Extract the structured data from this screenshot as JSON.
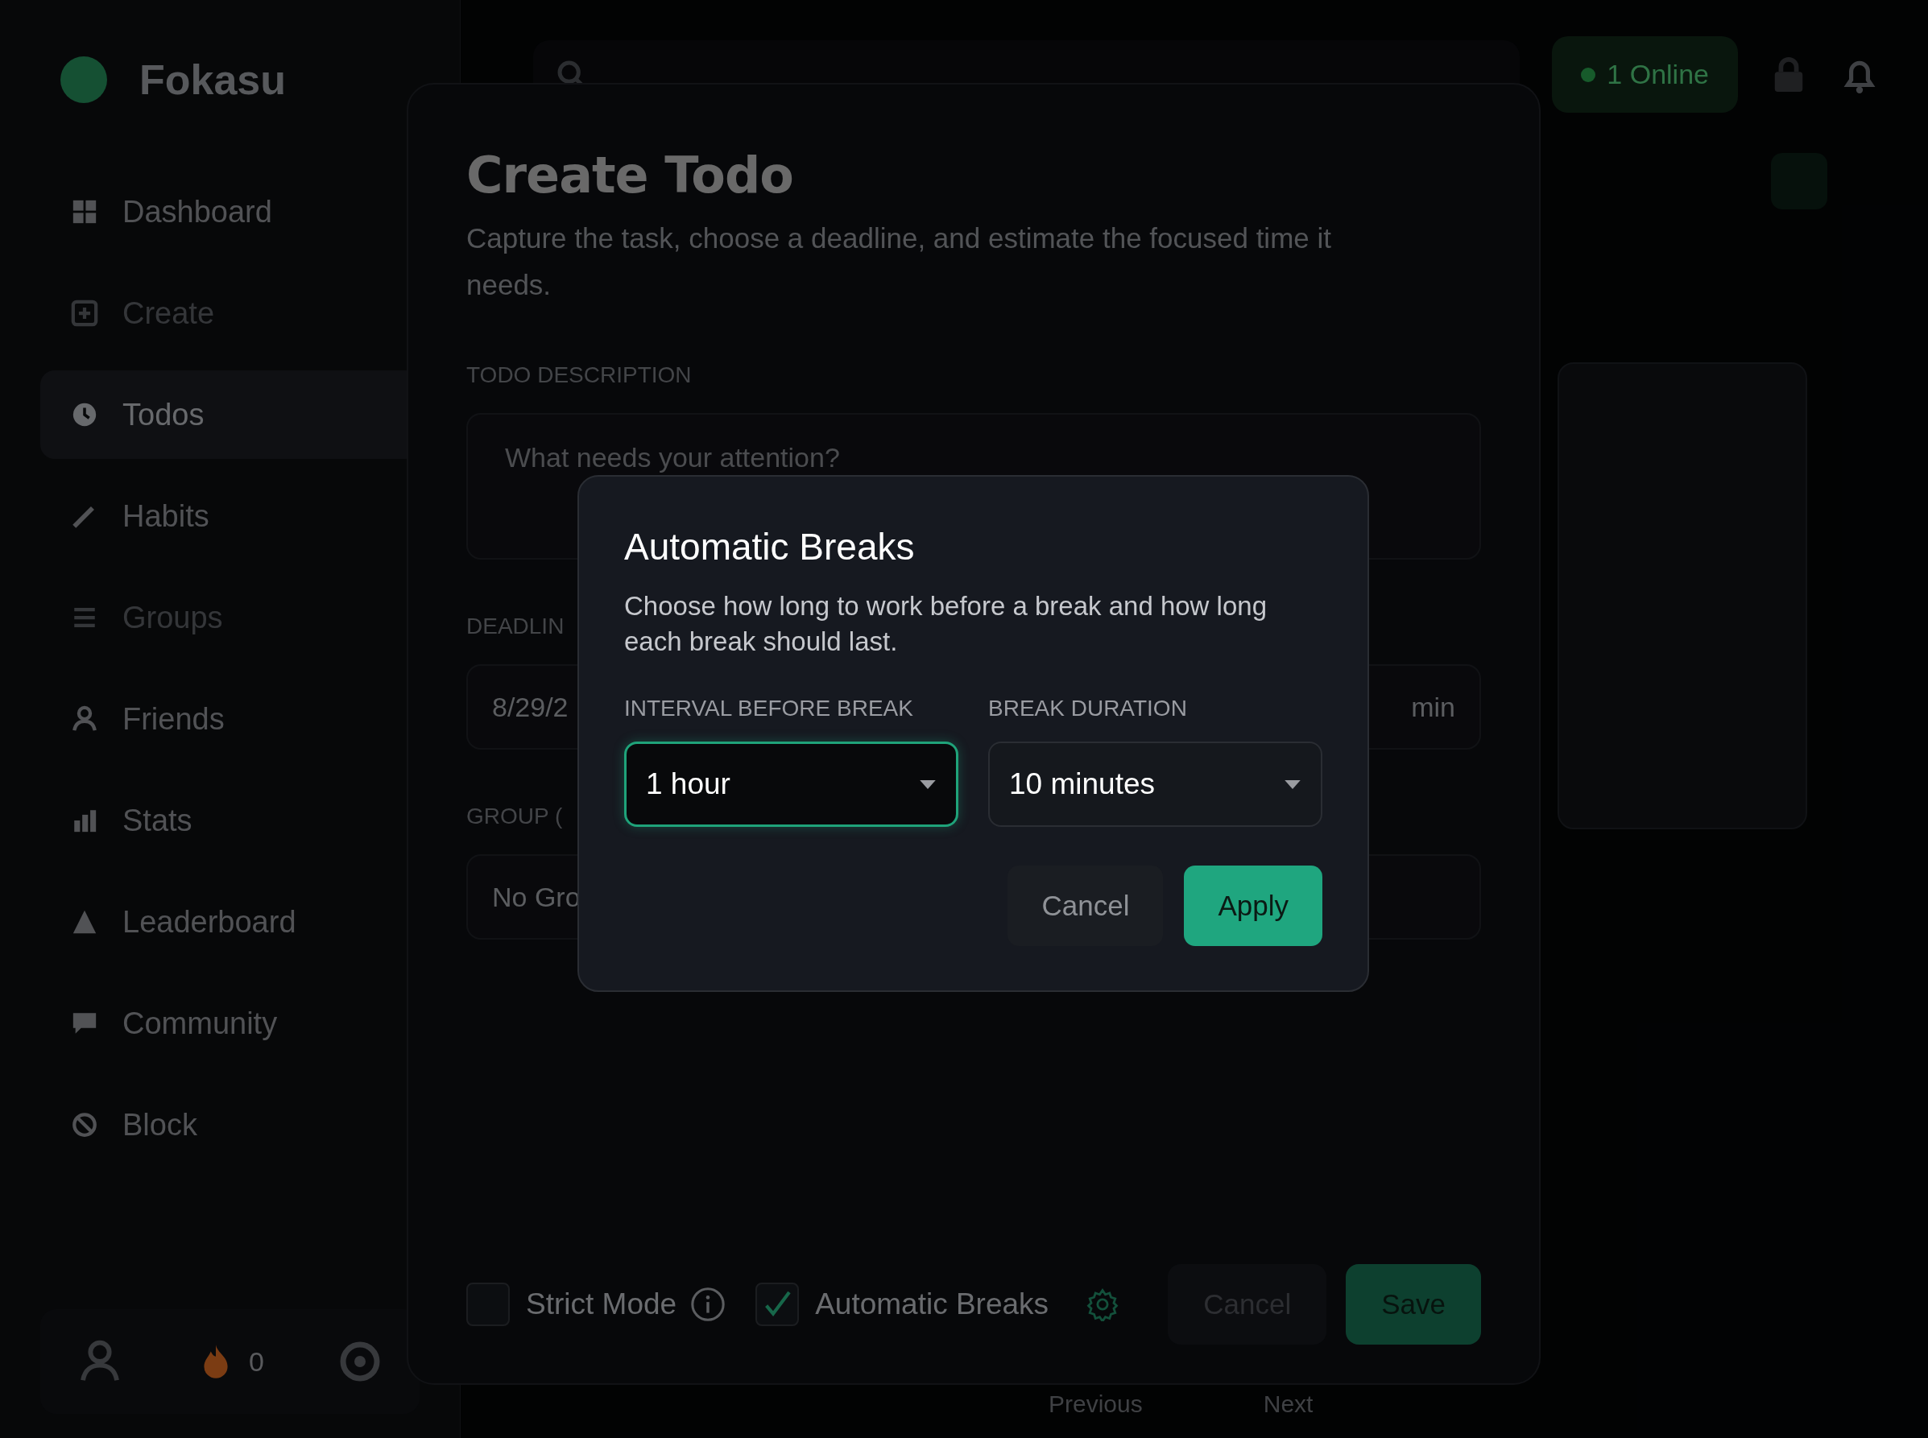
{
  "app": {
    "brand": "Fokasu",
    "sidebar": {
      "items": [
        {
          "label": "Dashboard",
          "selected": false,
          "disabled": false
        },
        {
          "label": "Create",
          "selected": false,
          "disabled": true
        },
        {
          "label": "Todos",
          "selected": true,
          "disabled": false
        },
        {
          "label": "Habits",
          "selected": false,
          "disabled": false
        },
        {
          "label": "Groups",
          "selected": false,
          "disabled": true
        },
        {
          "label": "Friends",
          "selected": false,
          "disabled": false
        },
        {
          "label": "Stats",
          "selected": false,
          "disabled": false
        },
        {
          "label": "Leaderboard",
          "selected": false,
          "disabled": false
        },
        {
          "label": "Community",
          "selected": false,
          "disabled": false
        },
        {
          "label": "Block",
          "selected": false,
          "disabled": false
        }
      ]
    },
    "streak": "0",
    "online": "1 Online",
    "pagination": {
      "previous": "Previous",
      "next": "Next"
    }
  },
  "create_todo": {
    "title": "Create Todo",
    "description": "Capture the task, choose a deadline, and estimate the focused time it needs.",
    "description_label": "TODO DESCRIPTION",
    "description_placeholder": "What needs your attention?",
    "deadline_label": "DEADLIN",
    "deadline_value": "8/29/2",
    "estimate_unit": "min",
    "group_label": "GROUP (",
    "group_value": "No Gro",
    "options": [
      {
        "label": "Strict Mode",
        "checked": false,
        "kind": "info"
      },
      {
        "label": "Automatic Breaks",
        "checked": true,
        "kind": "settings"
      }
    ],
    "buttons": [
      {
        "label": "Cancel",
        "kind": "secondary"
      },
      {
        "label": "Save",
        "kind": "primary"
      }
    ]
  },
  "breaks_dialog": {
    "title": "Automatic Breaks",
    "description": "Choose how long to work before a break and how long each break should last.",
    "selects": [
      {
        "label": "INTERVAL BEFORE BREAK",
        "value": "1 hour",
        "focused": true
      },
      {
        "label": "BREAK DURATION",
        "value": "10 minutes",
        "focused": false
      }
    ],
    "buttons": [
      {
        "label": "Cancel",
        "kind": "secondary"
      },
      {
        "label": "Apply",
        "kind": "primary"
      }
    ]
  }
}
